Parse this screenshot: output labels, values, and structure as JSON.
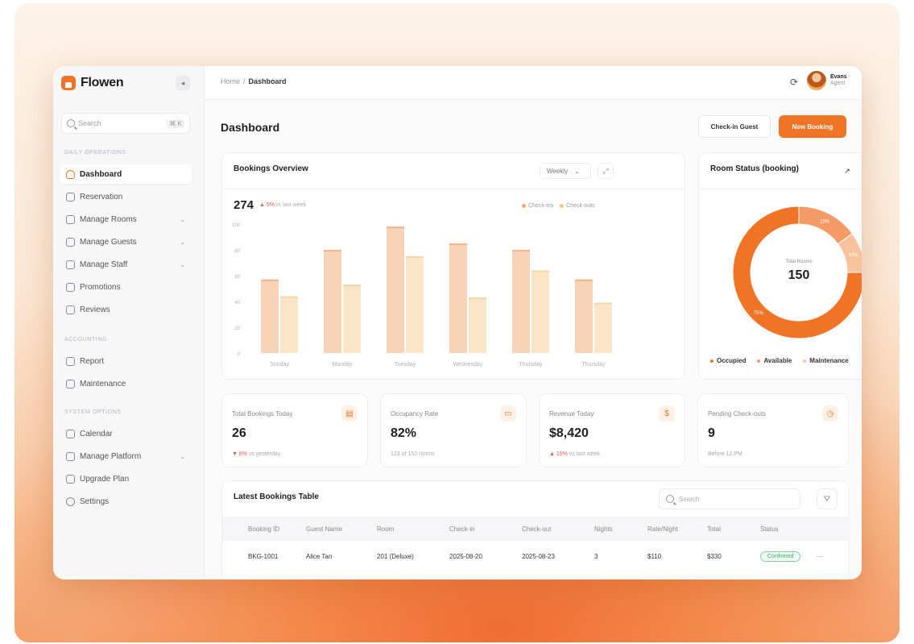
{
  "brand": {
    "name": "Flowen"
  },
  "sidebar": {
    "search_placeholder": "Search",
    "search_shortcut": "⌘ K",
    "section_operations": "DAILY OPERATIONS",
    "section_accounting": "ACCOUNTING",
    "section_system": "SYSTEM OPTIONS",
    "items": [
      {
        "label": "Dashboard",
        "active": true
      },
      {
        "label": "Reservation"
      },
      {
        "label": "Manage Rooms",
        "chevron": true
      },
      {
        "label": "Manage Guests",
        "chevron": true
      },
      {
        "label": "Manage Staff",
        "chevron": true
      },
      {
        "label": "Promotions"
      },
      {
        "label": "Reviews"
      },
      {
        "label": "Report"
      },
      {
        "label": "Maintenance"
      },
      {
        "label": "Calendar"
      },
      {
        "label": "Manage Platform",
        "chevron": true
      },
      {
        "label": "Upgrade Plan"
      },
      {
        "label": "Settings"
      }
    ]
  },
  "topbar": {
    "breadcrumb_home": "Home",
    "breadcrumb_sep": "/",
    "breadcrumb_current": "Dashboard",
    "user_name": "Evans",
    "user_role": "Agent"
  },
  "page": {
    "title": "Dashboard",
    "check_in_label": "Check-in Guest",
    "new_booking_label": "New Booking"
  },
  "overview": {
    "title": "Bookings Overview",
    "period": "Weekly",
    "total": "274",
    "delta": "▲ 5%",
    "delta_note": "vs last week",
    "legend_in": "Check-ins",
    "legend_out": "Check-outs"
  },
  "chart_data": {
    "type": "bar",
    "categories": [
      "Sunday",
      "Monday",
      "Tuesday",
      "Wednesday",
      "Thursday",
      "Thursday"
    ],
    "series": [
      {
        "name": "Check-ins",
        "values": [
          57,
          80,
          98,
          85,
          80,
          57
        ],
        "color": "#f8d3b8"
      },
      {
        "name": "Check-outs",
        "values": [
          44,
          53,
          75,
          43,
          64,
          39
        ],
        "color": "#fbe5c7"
      }
    ],
    "ylim": [
      0,
      100
    ],
    "yticks": [
      0,
      20,
      40,
      60,
      80,
      100
    ]
  },
  "room_status": {
    "title": "Room Status (booking)",
    "center_label": "Total Rooms",
    "center_value": "150",
    "legend": [
      "Occupied",
      "Available",
      "Maintenance"
    ],
    "segments": [
      {
        "name": "Occupied",
        "value": 75,
        "color": "#f07426",
        "label": "75%"
      },
      {
        "name": "Available",
        "value": 15,
        "color": "#f39a65",
        "label": "15%"
      },
      {
        "name": "Maintenance",
        "value": 10,
        "color": "#f8c29d",
        "label": "10%"
      }
    ]
  },
  "stats": [
    {
      "label": "Total Bookings Today",
      "value": "26",
      "neg": "▼ 8%",
      "sub": "vs yesterday",
      "icon": "calendar-icon"
    },
    {
      "label": "Occupancy Rate",
      "value": "82%",
      "neg": "",
      "sub": "123 of 150 rooms",
      "icon": "bed-icon"
    },
    {
      "label": "Revenue Today",
      "value": "$8,420",
      "neg": "▲ 15%",
      "sub": "vs last week",
      "icon": "dollar-icon"
    },
    {
      "label": "Pending Check-outs",
      "value": "9",
      "neg": "",
      "sub": "Before 12 PM",
      "icon": "clock-icon"
    }
  ],
  "table": {
    "title": "Latest Bookings Table",
    "search_placeholder": "Search",
    "headers": [
      "Booking ID",
      "Guest Name",
      "Room",
      "Check-in",
      "Check-out",
      "Nights",
      "Rate/Night",
      "Total",
      "Status"
    ],
    "rows": [
      [
        "BKG-1001",
        "Alice Tan",
        "201 (Deluxe)",
        "2025-08-20",
        "2025-08-23",
        "3",
        "$110",
        "$330",
        "Confirmed"
      ]
    ]
  }
}
